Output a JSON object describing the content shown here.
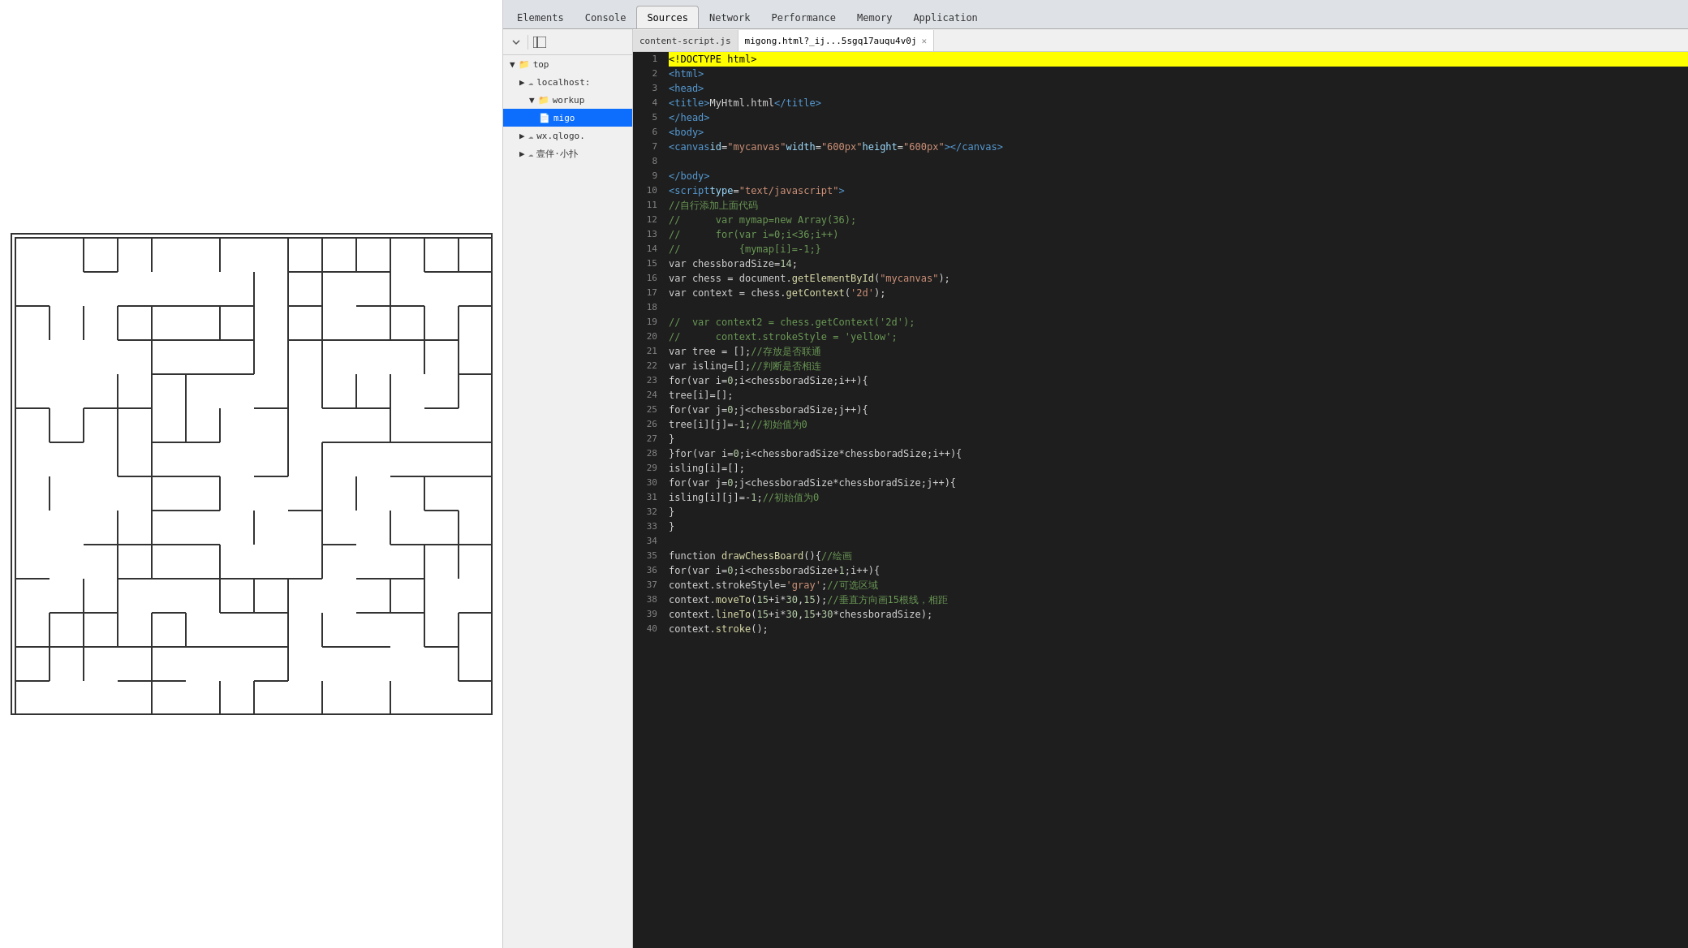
{
  "devtools": {
    "tabs": [
      {
        "label": "Elements",
        "active": false
      },
      {
        "label": "Console",
        "active": false
      },
      {
        "label": "Sources",
        "active": true
      },
      {
        "label": "Network",
        "active": false
      },
      {
        "label": "Performance",
        "active": false
      },
      {
        "label": "Memory",
        "active": false
      },
      {
        "label": "Application",
        "active": false
      }
    ]
  },
  "sources": {
    "file_tabs": [
      {
        "label": "content-script.js",
        "active": false,
        "closable": false
      },
      {
        "label": "migong.html?_ij...5sgq17auqu4v0j",
        "active": true,
        "closable": true
      }
    ],
    "tree": [
      {
        "label": "top",
        "indent": 1,
        "type": "folder",
        "icon": "▶ 📁"
      },
      {
        "label": "localhost:",
        "indent": 2,
        "type": "cloud"
      },
      {
        "label": "workup",
        "indent": 3,
        "type": "folder"
      },
      {
        "label": "migo",
        "indent": 4,
        "type": "file",
        "selected": true
      },
      {
        "label": "wx.qlogo.",
        "indent": 2,
        "type": "cloud"
      },
      {
        "label": "壹伴·小扑",
        "indent": 2,
        "type": "cloud"
      }
    ]
  },
  "code": {
    "lines": [
      {
        "n": 1,
        "content": "<!DOCTYPE html>",
        "highlight": true
      },
      {
        "n": 2,
        "content": "<html>"
      },
      {
        "n": 3,
        "content": "<head>"
      },
      {
        "n": 4,
        "content": "    <title>MyHtml.html</title>"
      },
      {
        "n": 5,
        "content": "</head>"
      },
      {
        "n": 6,
        "content": "<body>"
      },
      {
        "n": 7,
        "content": "<canvas id=\"mycanvas\" width=\"600px\" height=\"600px\"></canvas>"
      },
      {
        "n": 8,
        "content": ""
      },
      {
        "n": 9,
        "content": "</body>"
      },
      {
        "n": 10,
        "content": "<script type=\"text/javascript\">"
      },
      {
        "n": 11,
        "content": "    //自行添加上面代码"
      },
      {
        "n": 12,
        "content": "    //      var mymap=new Array(36);"
      },
      {
        "n": 13,
        "content": "    //      for(var i=0;i<36;i++)"
      },
      {
        "n": 14,
        "content": "    //          {mymap[i]=-1;}"
      },
      {
        "n": 15,
        "content": "    var chessboradSize=14;"
      },
      {
        "n": 16,
        "content": "    var chess = document.getElementById(\"mycanvas\");"
      },
      {
        "n": 17,
        "content": "    var context = chess.getContext('2d');"
      },
      {
        "n": 18,
        "content": ""
      },
      {
        "n": 19,
        "content": "    //  var context2 = chess.getContext('2d');"
      },
      {
        "n": 20,
        "content": "    //      context.strokeStyle = 'yellow';"
      },
      {
        "n": 21,
        "content": "    var tree = [];//存放是否联通"
      },
      {
        "n": 22,
        "content": "    var isling=[];//判断是否相连"
      },
      {
        "n": 23,
        "content": "    for(var i=0;i<chessboradSize;i++){"
      },
      {
        "n": 24,
        "content": "        tree[i]=[];"
      },
      {
        "n": 25,
        "content": "        for(var j=0;j<chessboradSize;j++){"
      },
      {
        "n": 26,
        "content": "            tree[i][j]=-1;//初始值为0"
      },
      {
        "n": 27,
        "content": "        }"
      },
      {
        "n": 28,
        "content": "    }  for(var i=0;i<chessboradSize*chessboradSize;i++){"
      },
      {
        "n": 29,
        "content": "        isling[i]=[];"
      },
      {
        "n": 30,
        "content": "        for(var j=0;j<chessboradSize*chessboradSize;j++){"
      },
      {
        "n": 31,
        "content": "            isling[i][j]=-1;//初始值为0"
      },
      {
        "n": 32,
        "content": "        }"
      },
      {
        "n": 33,
        "content": "    }"
      },
      {
        "n": 34,
        "content": ""
      },
      {
        "n": 35,
        "content": "    function drawChessBoard(){//绘画"
      },
      {
        "n": 36,
        "content": "        for(var i=0;i<chessboradSize+1;i++){"
      },
      {
        "n": 37,
        "content": "            context.strokeStyle='gray';//可选区域"
      },
      {
        "n": 38,
        "content": "            context.moveTo(15+i*30,15);//垂直方向画15根线，相距"
      },
      {
        "n": 39,
        "content": "            context.lineTo(15+i*30,15+30*chessboradSize);"
      },
      {
        "n": 40,
        "content": "            context.stroke();"
      }
    ]
  }
}
